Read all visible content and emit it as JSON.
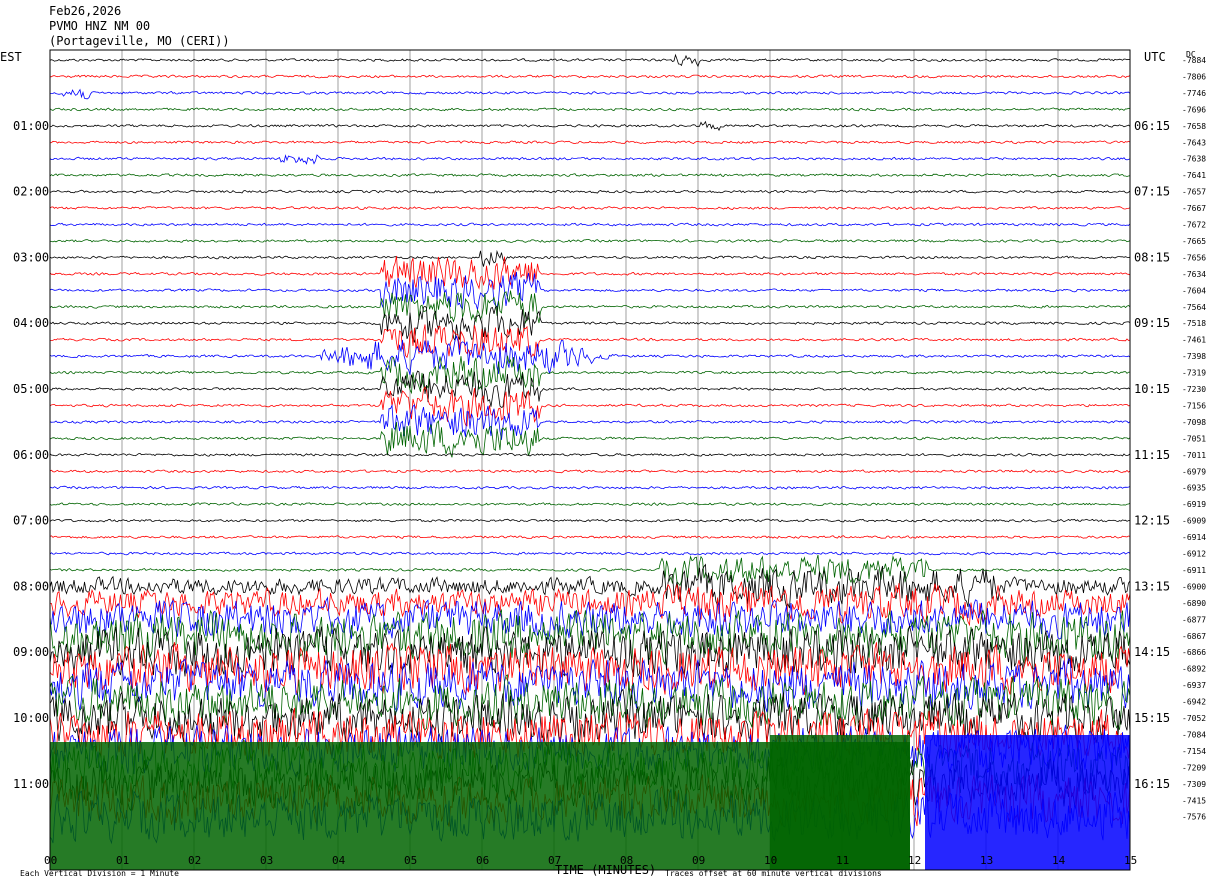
{
  "header": {
    "date": "Feb26,2026",
    "station": "PVMO HNZ NM 00",
    "location": "(Portageville, MO (CERI))"
  },
  "chart_data": {
    "type": "line",
    "title": "PVMO HNZ NM 00",
    "xlabel": "TIME (MINUTES)",
    "left_axis_label": "EST",
    "right_axis_label": "UTC",
    "right_axis_units": "DC",
    "xlim": [
      0,
      15
    ],
    "x_ticks": [
      "00",
      "01",
      "02",
      "03",
      "04",
      "05",
      "06",
      "07",
      "08",
      "09",
      "10",
      "11",
      "12",
      "13",
      "14",
      "15"
    ],
    "left_hour_labels": [
      "01:00",
      "02:00",
      "03:00",
      "04:00",
      "05:00",
      "06:00",
      "07:00",
      "08:00",
      "09:00",
      "10:00",
      "11:00"
    ],
    "right_hour_labels": [
      "06:15",
      "07:15",
      "08:15",
      "09:15",
      "10:15",
      "11:15",
      "12:15",
      "13:15",
      "14:15",
      "15:15",
      "16:15"
    ],
    "dc_offsets": [
      -7884,
      -7806,
      -7746,
      -7696,
      -7658,
      -7643,
      -7638,
      -7641,
      -7657,
      -7667,
      -7672,
      -7665,
      -7656,
      -7634,
      -7604,
      -7564,
      -7518,
      -7461,
      -7398,
      -7319,
      -7230,
      -7156,
      -7098,
      -7051,
      -7011,
      -6979,
      -6935,
      -6919,
      -6909,
      -6914,
      -6912,
      -6911,
      -6900,
      -6890,
      -6877,
      -6867,
      -6866,
      -6892,
      -6937,
      -6942,
      -7052,
      -7084,
      -7154,
      -7209,
      -7309,
      -7415,
      -7576
    ],
    "trace_colors": [
      "#000000",
      "#ff0000",
      "#0000ff",
      "#006400"
    ],
    "footer_left": "Each Vertical Division = 1 Minute",
    "footer_right": "Traces offset at 60 minute vertical divisions"
  }
}
